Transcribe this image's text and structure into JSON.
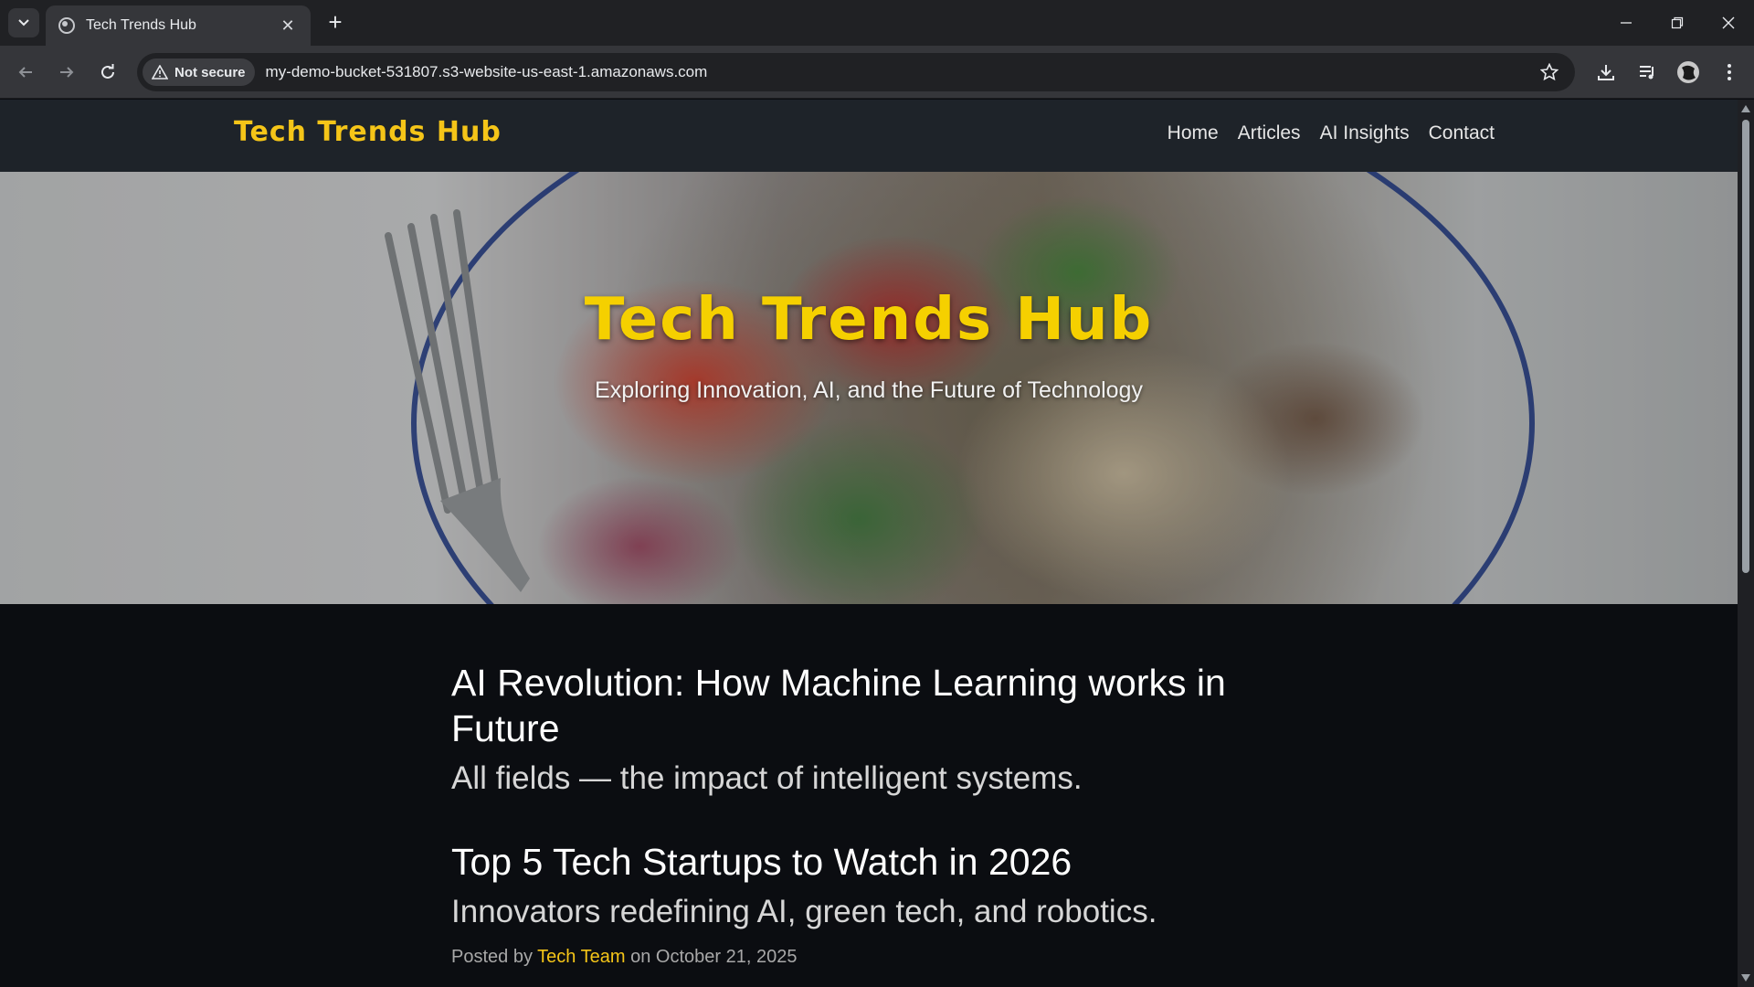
{
  "browser": {
    "tab_title": "Tech Trends Hub",
    "security_label": "Not secure",
    "url": "my-demo-bucket-531807.s3-website-us-east-1.amazonaws.com"
  },
  "site": {
    "brand": "Tech Trends Hub",
    "nav": [
      "Home",
      "Articles",
      "AI Insights",
      "Contact"
    ]
  },
  "hero": {
    "title": "Tech Trends Hub",
    "subtitle": "Exploring Innovation, AI, and the Future of Technology"
  },
  "articles": [
    {
      "title": "AI Revolution: How Machine Learning works in Future",
      "subtitle": "All fields — the impact of intelligent systems."
    },
    {
      "title": "Top 5 Tech Startups to Watch in 2026",
      "subtitle": "Innovators redefining AI, green tech, and robotics.",
      "meta_prefix": "Posted by",
      "author": "Tech Team",
      "meta_mid": "on",
      "date": "October 21, 2025"
    }
  ],
  "colors": {
    "accent": "#f5c518",
    "header_bg": "#1e2329",
    "page_bg": "#0b0d11"
  }
}
